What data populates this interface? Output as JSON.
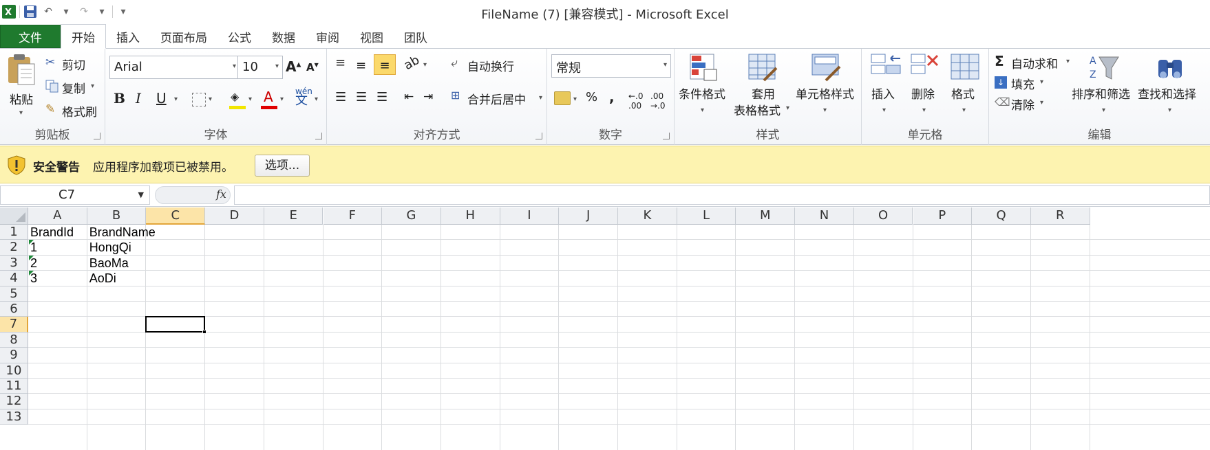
{
  "window": {
    "title": "FileName (7)  [兼容模式] - Microsoft Excel"
  },
  "ribbon_tabs": [
    "文件",
    "开始",
    "插入",
    "页面布局",
    "公式",
    "数据",
    "审阅",
    "视图",
    "团队"
  ],
  "clipboard": {
    "paste": "粘贴",
    "cut": "剪切",
    "copy": "复制",
    "format_painter": "格式刷",
    "label": "剪贴板"
  },
  "font": {
    "name": "Arial",
    "size": "10",
    "bold": "B",
    "italic": "I",
    "underline": "U",
    "font_color_letter": "A",
    "label": "字体"
  },
  "alignment": {
    "wrap_text": "自动换行",
    "merge_center": "合并后居中",
    "label": "对齐方式"
  },
  "number": {
    "format": "常规",
    "percent": "%",
    "comma": ",",
    "label": "数字"
  },
  "styles": {
    "conditional": "条件格式",
    "table_1": "套用",
    "table_2": "表格格式",
    "cell_styles": "单元格样式",
    "label": "样式"
  },
  "cells": {
    "insert": "插入",
    "delete": "删除",
    "format": "格式",
    "label": "单元格"
  },
  "editing": {
    "autosum": "自动求和",
    "fill": "填充",
    "clear": "清除",
    "sort_filter": "排序和筛选",
    "find_select": "查找和选择",
    "label": "编辑"
  },
  "security": {
    "title": "安全警告",
    "message": "应用程序加载项已被禁用。",
    "button": "选项..."
  },
  "formula_bar": {
    "name_box": "C7",
    "fx": "fx",
    "value": ""
  },
  "sheet": {
    "columns": [
      "A",
      "B",
      "C",
      "D",
      "E",
      "F",
      "G",
      "H",
      "I",
      "J",
      "K",
      "L",
      "M",
      "N",
      "O",
      "P",
      "Q",
      "R"
    ],
    "rows": [
      "1",
      "2",
      "3",
      "4",
      "5",
      "6",
      "7",
      "8",
      "9",
      "10",
      "11",
      "12",
      "13"
    ],
    "data": [
      [
        "BrandId",
        "BrandName"
      ],
      [
        "1",
        "HongQi"
      ],
      [
        "2",
        "BaoMa"
      ],
      [
        "3",
        "AoDi"
      ]
    ],
    "active_cell": "C7"
  },
  "colors": {
    "file_tab": "#1f7a2e",
    "security_bar": "#fdf3b0",
    "selected_header": "#fce4a8"
  }
}
